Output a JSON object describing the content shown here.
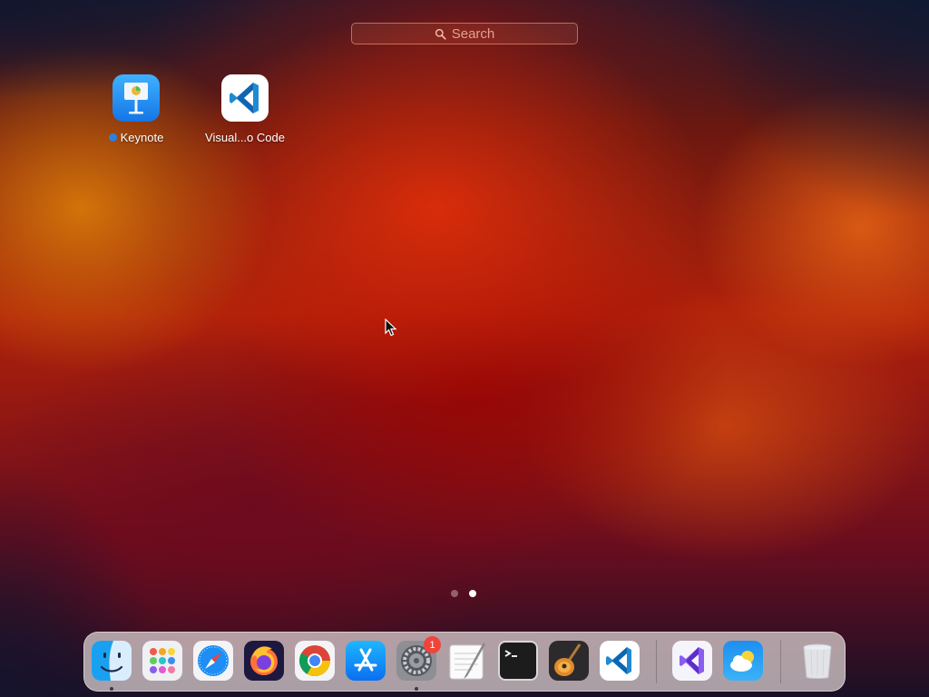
{
  "search": {
    "placeholder": "Search"
  },
  "apps": [
    {
      "name": "Keynote",
      "icon": "keynote-icon",
      "new": true
    },
    {
      "name": "Visual...o Code",
      "icon": "vscode-icon",
      "new": false
    }
  ],
  "pager": {
    "pages": 2,
    "current": 2
  },
  "dock": {
    "items": [
      {
        "name": "Finder",
        "icon": "finder-icon",
        "running": true
      },
      {
        "name": "Launchpad",
        "icon": "launchpad-icon",
        "running": false
      },
      {
        "name": "Safari",
        "icon": "safari-icon",
        "running": false
      },
      {
        "name": "Firefox",
        "icon": "firefox-icon",
        "running": false
      },
      {
        "name": "Google Chrome",
        "icon": "chrome-icon",
        "running": false
      },
      {
        "name": "App Store",
        "icon": "app-store-icon",
        "running": false
      },
      {
        "name": "System Preferences",
        "icon": "gear-icon",
        "running": true,
        "badge": "1"
      },
      {
        "name": "TextEdit",
        "icon": "textedit-icon",
        "running": false
      },
      {
        "name": "Terminal",
        "icon": "terminal-icon",
        "running": false
      },
      {
        "name": "GarageBand",
        "icon": "guitar-icon",
        "running": false
      },
      {
        "name": "Visual Studio Code",
        "icon": "vscode-icon",
        "running": false
      },
      {
        "name": "Visual Studio",
        "icon": "visual-studio-icon",
        "running": false
      },
      {
        "name": "Weather",
        "icon": "weather-icon",
        "running": false
      },
      {
        "name": "Trash",
        "icon": "trash-icon",
        "running": false
      }
    ]
  },
  "colors": {
    "accent_blue": "#2d7fe3",
    "badge_red": "#f0443a"
  }
}
